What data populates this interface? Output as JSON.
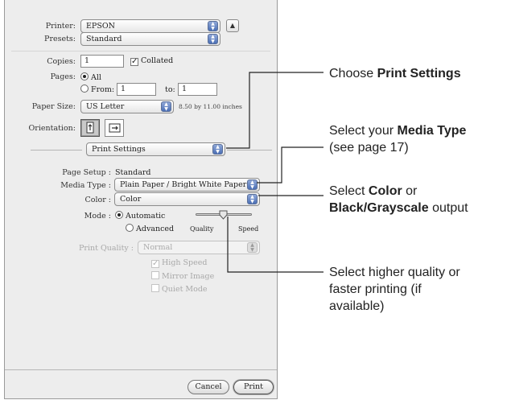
{
  "dialog": {
    "printer": {
      "label": "Printer:",
      "value": "EPSON"
    },
    "presets": {
      "label": "Presets:",
      "value": "Standard"
    },
    "copies": {
      "label": "Copies:",
      "value": "1",
      "collated_label": "Collated",
      "collated_checked": true
    },
    "pages": {
      "label": "Pages:",
      "all_label": "All",
      "from_label": "From:",
      "from_value": "1",
      "to_label": "to:",
      "to_value": "1",
      "selected": "All"
    },
    "paper_size": {
      "label": "Paper Size:",
      "value": "US Letter",
      "dimensions": "8.50 by 11.00 inches"
    },
    "orientation": {
      "label": "Orientation:",
      "selected": "portrait"
    },
    "panel_menu": {
      "value": "Print Settings"
    },
    "page_setup": {
      "label": "Page Setup :",
      "value": "Standard"
    },
    "media_type": {
      "label": "Media Type :",
      "value": "Plain Paper / Bright White Paper"
    },
    "color": {
      "label": "Color :",
      "value": "Color"
    },
    "mode": {
      "label": "Mode :",
      "automatic_label": "Automatic",
      "advanced_label": "Advanced",
      "selected": "Automatic"
    },
    "slider": {
      "quality_label": "Quality",
      "speed_label": "Speed"
    },
    "print_quality": {
      "label": "Print Quality :",
      "value": "Normal"
    },
    "options": [
      {
        "label": "High Speed",
        "checked": true
      },
      {
        "label": "Mirror Image",
        "checked": false
      },
      {
        "label": "Quiet Mode",
        "checked": false
      }
    ],
    "cancel_label": "Cancel",
    "print_label": "Print"
  },
  "callouts": [
    {
      "prefix": "Choose ",
      "bold": "Print Settings",
      "suffix": ""
    },
    {
      "prefix": "Select your ",
      "bold": "Media Type",
      "line2": "(see page 17)"
    },
    {
      "prefix": "Select ",
      "bold": "Color",
      "suffix": " or",
      "line2_bold": "Black/Grayscale",
      "line2_suffix": " output"
    },
    {
      "line1": "Select higher quality or",
      "line2": "faster printing (if",
      "line3": "available)"
    }
  ]
}
